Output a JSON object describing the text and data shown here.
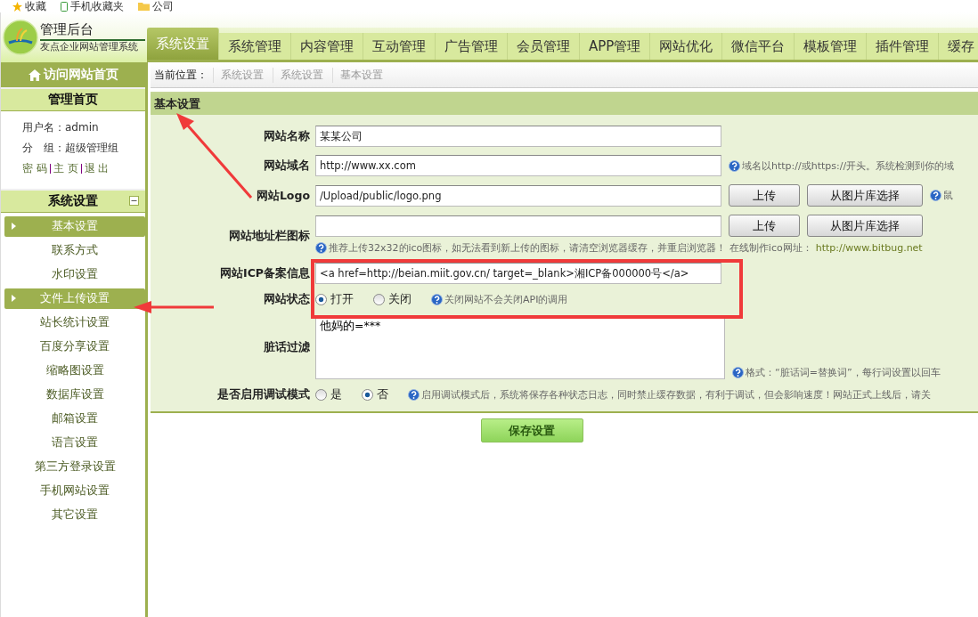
{
  "bookmarks": [
    "收藏",
    "手机收藏夹",
    "公司"
  ],
  "logo": {
    "title": "管理后台",
    "subtitle": "友点企业网站管理系统"
  },
  "tabs": [
    {
      "label": "系统设置",
      "selected": true
    },
    {
      "label": "系统管理",
      "selected": false
    },
    {
      "label": "内容管理",
      "selected": false
    },
    {
      "label": "互动管理",
      "selected": false
    },
    {
      "label": "广告管理",
      "selected": false
    },
    {
      "label": "会员管理",
      "selected": false
    },
    {
      "label": "APP管理",
      "selected": false
    },
    {
      "label": "网站优化",
      "selected": false
    },
    {
      "label": "微信平台",
      "selected": false
    },
    {
      "label": "模板管理",
      "selected": false
    },
    {
      "label": "插件管理",
      "selected": false
    },
    {
      "label": "缓存",
      "selected": false
    }
  ],
  "sidebar": {
    "visit_home": "访问网站首页",
    "home_title": "管理首页",
    "user": {
      "name_label": "用户名：",
      "name": "admin",
      "group_label": "分　组：",
      "group": "超级管理组",
      "links": [
        "密 码",
        "主 页",
        "退 出"
      ]
    },
    "section_title": "系统设置",
    "expanded": true,
    "items": [
      {
        "label": "基本设置",
        "selected": true
      },
      {
        "label": "联系方式",
        "selected": false
      },
      {
        "label": "水印设置",
        "selected": false
      },
      {
        "label": "文件上传设置",
        "selected": true
      },
      {
        "label": "站长统计设置",
        "selected": false
      },
      {
        "label": "百度分享设置",
        "selected": false
      },
      {
        "label": "缩略图设置",
        "selected": false
      },
      {
        "label": "数据库设置",
        "selected": false
      },
      {
        "label": "邮箱设置",
        "selected": false
      },
      {
        "label": "语言设置",
        "selected": false
      },
      {
        "label": "第三方登录设置",
        "selected": false
      },
      {
        "label": "手机网站设置",
        "selected": false
      },
      {
        "label": "其它设置",
        "selected": false
      }
    ]
  },
  "breadcrumb": {
    "label": "当前位置：",
    "items": [
      "系统设置",
      "系统设置",
      "基本设置"
    ]
  },
  "panel": {
    "title": "基本设置",
    "fields": [
      {
        "kind": "text",
        "label": "网站名称",
        "value": "某某公司"
      },
      {
        "kind": "text",
        "label": "网站域名",
        "value": "http://www.xx.com",
        "hint": "域名以http://或https://开头。系统检测到你的域"
      },
      {
        "kind": "upload",
        "label": "网站Logo",
        "value": "/Upload/public/logo.png",
        "buttons": [
          "上传",
          "从图片库选择"
        ],
        "hint": "鼠"
      },
      {
        "kind": "upload",
        "label": "网站地址栏图标",
        "buttons": [
          "上传",
          "从图片库选择"
        ],
        "note": "推荐上传32x32的ico图标，如无法看到新上传的图标，请清空浏览器缓存，并重启浏览器！ 在线制作ico网址：",
        "note_link": "http://www.bitbug.net"
      },
      {
        "kind": "text",
        "label": "网站ICP备案信息",
        "value": "<a href=http://beian.miit.gov.cn/ target=_blank>湘ICP备000000号</a>"
      },
      {
        "kind": "radio",
        "label": "网站状态",
        "options": [
          {
            "label": "打开",
            "selected": true
          },
          {
            "label": "关闭",
            "selected": false
          }
        ],
        "hint": "关闭网站不会关闭API的调用"
      },
      {
        "kind": "textarea",
        "label": "脏话过滤",
        "value": "他妈的=***",
        "hint": "格式：“脏话词=替换词”，每行词设置以回车"
      },
      {
        "kind": "radio",
        "label": "是否启用调试模式",
        "options": [
          {
            "label": "是",
            "selected": false
          },
          {
            "label": "否",
            "selected": true
          }
        ],
        "hint": "启用调试模式后，系统将保存各种状态日志，同时禁止缓存数据，有利于调试，但会影响速度！网站正式上线后，请关"
      }
    ]
  },
  "save_button": "保存设置"
}
